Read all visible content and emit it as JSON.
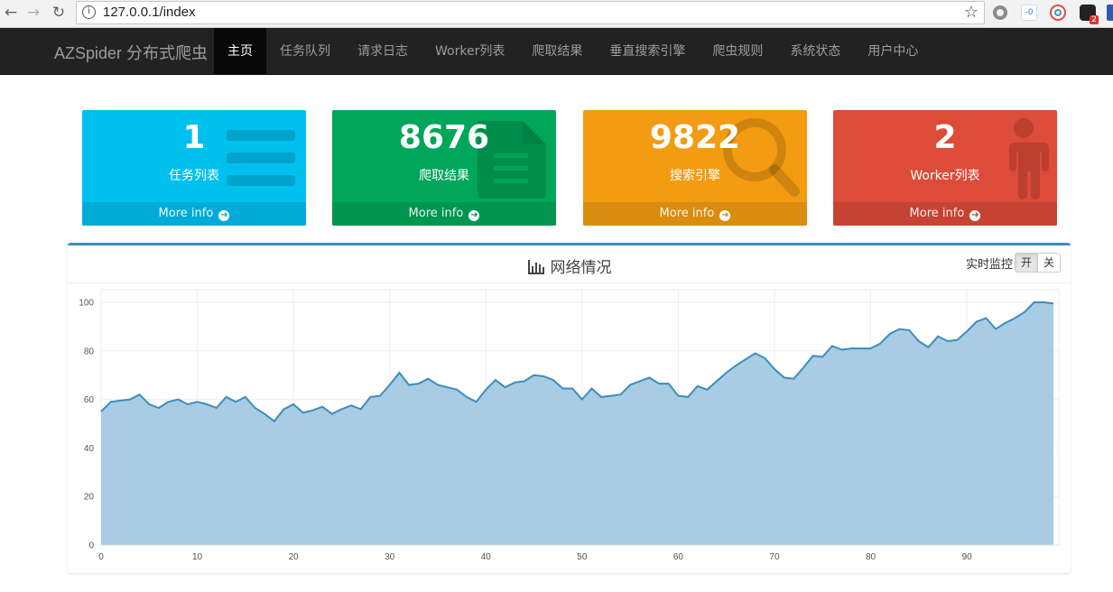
{
  "browser": {
    "url": "127.0.0.1/index",
    "ext_badge": "2"
  },
  "navbar": {
    "brand": "AZSpider 分布式爬虫",
    "items": [
      {
        "label": "主页",
        "active": true
      },
      {
        "label": "任务队列"
      },
      {
        "label": "请求日志"
      },
      {
        "label": "Worker列表"
      },
      {
        "label": "爬取结果"
      },
      {
        "label": "垂直搜索引擎"
      },
      {
        "label": "爬虫规则"
      },
      {
        "label": "系统状态"
      },
      {
        "label": "用户中心"
      }
    ]
  },
  "stats": [
    {
      "value": "1",
      "label": "任务列表",
      "more": "More info",
      "color": "#00c0ef",
      "icon": "list-icon"
    },
    {
      "value": "8676",
      "label": "爬取结果",
      "more": "More info",
      "color": "#00a65a",
      "icon": "document-icon"
    },
    {
      "value": "9822",
      "label": "搜索引擎",
      "more": "More info",
      "color": "#f39c12",
      "icon": "magnifier-icon"
    },
    {
      "value": "2",
      "label": "Worker列表",
      "more": "More info",
      "color": "#dd4b39",
      "icon": "person-icon"
    }
  ],
  "network": {
    "title": "网络情况",
    "realtime_label": "实时监控",
    "on_label": "开",
    "off_label": "关"
  },
  "chart_data": {
    "type": "area",
    "title": "网络情况",
    "xlabel": "",
    "ylabel": "",
    "xlim": [
      0,
      99
    ],
    "ylim": [
      0,
      100
    ],
    "xticks": [
      0,
      10,
      20,
      30,
      40,
      50,
      60,
      70,
      80,
      90
    ],
    "yticks": [
      0,
      20,
      40,
      60,
      80,
      100
    ],
    "grid": true,
    "line_color": "#3c8dbc",
    "fill_color": "#a8cce3",
    "x": [
      0,
      1,
      2,
      3,
      4,
      5,
      6,
      7,
      8,
      9,
      10,
      11,
      12,
      13,
      14,
      15,
      16,
      17,
      18,
      19,
      20,
      21,
      22,
      23,
      24,
      25,
      26,
      27,
      28,
      29,
      30,
      31,
      32,
      33,
      34,
      35,
      36,
      37,
      38,
      39,
      40,
      41,
      42,
      43,
      44,
      45,
      46,
      47,
      48,
      49,
      50,
      51,
      52,
      53,
      54,
      55,
      56,
      57,
      58,
      59,
      60,
      61,
      62,
      63,
      64,
      65,
      66,
      67,
      68,
      69,
      70,
      71,
      72,
      73,
      74,
      75,
      76,
      77,
      78,
      79,
      80,
      81,
      82,
      83,
      84,
      85,
      86,
      87,
      88,
      89,
      90,
      91,
      92,
      93,
      94,
      95,
      96,
      97,
      98,
      99
    ],
    "y": [
      55,
      59,
      59.5,
      60,
      62,
      58,
      56.5,
      59,
      60,
      58,
      59,
      58,
      56.5,
      61,
      59,
      61,
      56.5,
      54,
      51,
      56,
      58,
      54.5,
      55.5,
      57,
      54,
      56,
      57.5,
      56,
      61,
      61.5,
      66,
      71,
      66,
      66.5,
      68.5,
      66,
      65,
      64,
      61,
      59,
      64,
      68,
      65,
      67,
      67.5,
      70,
      69.5,
      68,
      64.5,
      64.5,
      60,
      64.5,
      61,
      61.5,
      62,
      66,
      67.5,
      69,
      66.5,
      66.5,
      61.5,
      61,
      65.5,
      64,
      67.5,
      71,
      74,
      76.5,
      79,
      77,
      72.5,
      69,
      68.5,
      73,
      78,
      77.5,
      82,
      80.5,
      81,
      81,
      81,
      83,
      87,
      89,
      88.5,
      84,
      81.5,
      86,
      84,
      84.5,
      88,
      92,
      93.5,
      89,
      91.5,
      93.5,
      96,
      100,
      100,
      99.5
    ]
  }
}
